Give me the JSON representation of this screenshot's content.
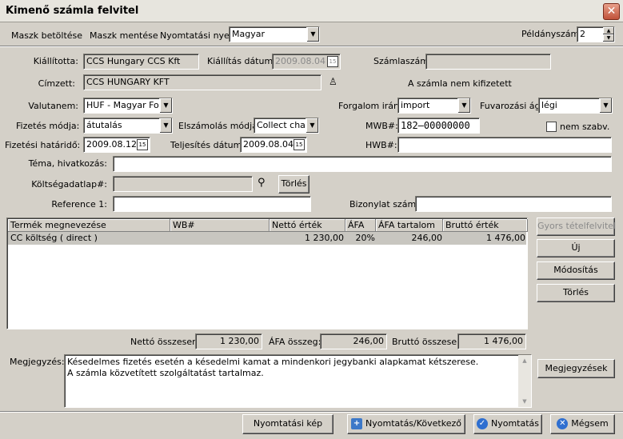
{
  "window": {
    "title": "Kimenő számla felvitel"
  },
  "toolbar": {
    "load_mask": "Maszk betöltése",
    "save_mask": "Maszk mentése",
    "print_lang_label": "Nyomtatási nyelv:",
    "print_lang_value": "Magyar",
    "copies_label": "Példányszám:",
    "copies_value": "2"
  },
  "header": {
    "issuer_label": "Kiállította:",
    "issuer_value": "CCS Hungary CCS Kft",
    "issue_date_label": "Kiállítás dátuma:",
    "issue_date_value": "2009.08.04",
    "invoice_no_label": "Számlaszám:",
    "invoice_no_value": "",
    "addressee_label": "Címzett:",
    "addressee_value": "CCS HUNGARY KFT",
    "paid_status": "A számla nem kifizetett",
    "currency_label": "Valutanem:",
    "currency_value": "HUF - Magyar Forint",
    "traffic_label": "Forgalom irány:",
    "traffic_value": "import",
    "transport_label": "Fuvarozási ág:",
    "transport_value": "légi",
    "payment_label": "Fizetés módja:",
    "payment_value": "átutalás",
    "settlement_label": "Elszámolás módja:",
    "settlement_value": "Collect charges",
    "mwb_label": "MWB#:",
    "mwb_value": "182—00000000",
    "non_std_label": "nem szabv.",
    "deadline_label": "Fizetési határidő:",
    "deadline_value": "2009.08.12",
    "completion_label": "Teljesítés dátuma:",
    "completion_value": "2009.08.04",
    "hwb_label": "HWB#:",
    "hwb_value": "",
    "subject_label": "Téma, hivatkozás:",
    "subject_value": "",
    "cost_sheet_label": "Költségadatlap#:",
    "cost_sheet_value": "",
    "cost_clear_button": "Törlés",
    "reference_label": "Reference 1:",
    "reference_value": "",
    "voucher_label": "Bizonylat száma:",
    "voucher_value": ""
  },
  "table": {
    "columns": [
      "Termék megnevezése",
      "WB#",
      "Nettó érték",
      "ÁFA",
      "ÁFA tartalom",
      "Bruttó érték"
    ],
    "rows": [
      {
        "name": "CC költség ( direct )",
        "wb": "",
        "net": "1 230,00",
        "vat": "20%",
        "vat_amount": "246,00",
        "gross": "1 476,00"
      }
    ]
  },
  "side_buttons": {
    "quick": "Gyors tételfelvitel",
    "new": "Új",
    "modify": "Módosítás",
    "delete": "Törlés",
    "notes": "Megjegyzések"
  },
  "totals": {
    "net_label": "Nettó összesen:",
    "net_value": "1 230,00",
    "vat_label": "ÁFA összeg:",
    "vat_value": "246,00",
    "gross_label": "Bruttó összesen:",
    "gross_value": "1 476,00"
  },
  "notes": {
    "label": "Megjegyzés:",
    "line1": "Késedelmes fizetés esetén a késedelmi kamat a mindenkori jegybanki alapkamat kétszerese.",
    "line2": "A számla közvetített szolgáltatást tartalmaz."
  },
  "footer": {
    "preview": "Nyomtatási kép",
    "print_next": "Nyomtatás/Következő",
    "print": "Nyomtatás",
    "cancel": "Mégsem"
  },
  "colors": {
    "selected_row": "#c8c6c0",
    "window_bg": "#d4d0c8",
    "close_red": "#c0523a"
  }
}
